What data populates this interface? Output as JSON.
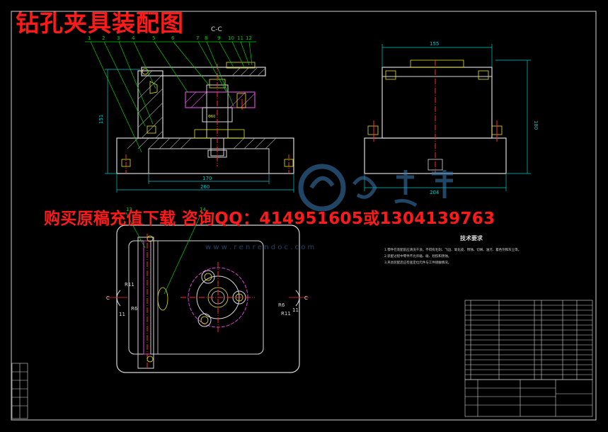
{
  "title": "钻孔夹具装配图",
  "promo_text": "购买原稿充值下载 咨询QQ：414951605或1304139763",
  "watermark": {
    "site": "w w w . r e n r e n d o c . c o m"
  },
  "views": {
    "section_label": "C-C",
    "part_numbers": [
      "1",
      "2",
      "3",
      "4",
      "5",
      "6",
      "7",
      "8",
      "9",
      "10",
      "11",
      "12",
      "13",
      "14"
    ],
    "front_dimensions": {
      "height": "151",
      "inner_width": "170",
      "overall_width": "260"
    },
    "side_dimensions": {
      "top_width": "155",
      "height": "180",
      "bottom_width": "204"
    },
    "plan_labels": {
      "radius_a": "R11",
      "radius_b": "R6",
      "section_mark_left": "C",
      "section_mark_right": "C",
      "dim_left": "11",
      "dim_right": "11"
    }
  },
  "notes": {
    "title": "技术要求",
    "items": [
      "1.零件在装配前应清洗干净，不得有毛刺、飞边、氧化皮、锈蚀、切屑、油污、着色剂和灰尘等。",
      "2.装配过程中零件不允许磕、碰、划伤和锈蚀。",
      "3.夹具装配后应检查定位元件与工件接触情况。"
    ]
  },
  "colors": {
    "background": "#000000",
    "outline": "#d8d8d8",
    "hatch": "#b0b0b0",
    "dimension": "#00c8c8",
    "leader": "#00d000",
    "centerline": "#ff2a2a",
    "magenta": "#d24bd2",
    "yellow": "#e8e020",
    "accent_red": "#ff1a1a",
    "watermark": "#3b7fb8"
  }
}
